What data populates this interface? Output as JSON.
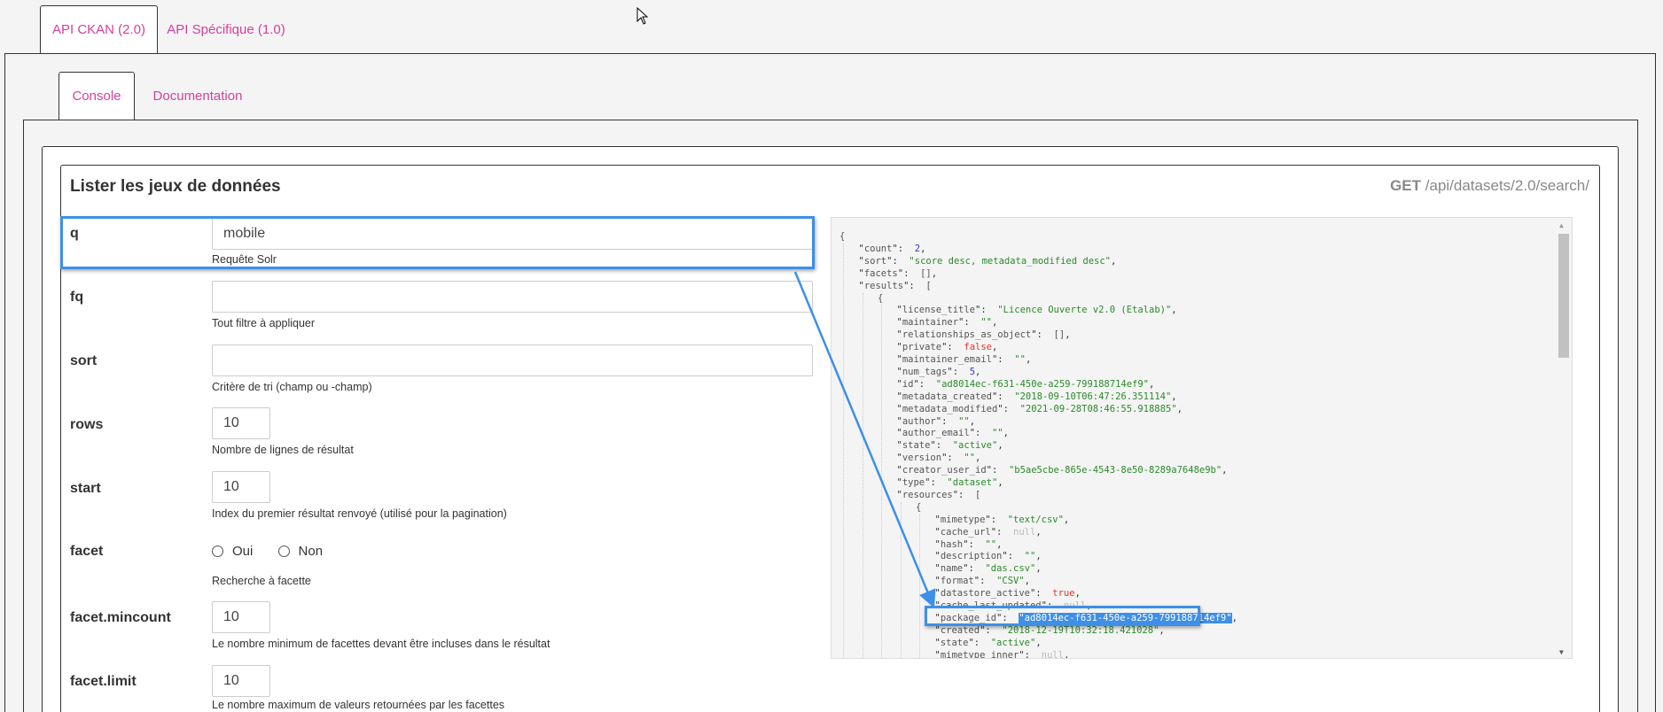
{
  "outer_tabs": [
    {
      "label": "API CKAN (2.0)",
      "active": true
    },
    {
      "label": "API Spécifique (1.0)",
      "active": false
    }
  ],
  "inner_tabs": [
    {
      "label": "Console",
      "active": true
    },
    {
      "label": "Documentation",
      "active": false
    }
  ],
  "card": {
    "title": "Lister les jeux de données",
    "method": "GET",
    "endpoint": "/api/datasets/2.0/search/"
  },
  "form": {
    "q": {
      "label": "q",
      "value": "mobile",
      "help": "Requête Solr"
    },
    "fq": {
      "label": "fq",
      "value": "",
      "help": "Tout filtre à appliquer"
    },
    "sort": {
      "label": "sort",
      "value": "",
      "help": "Critère de tri (champ ou -champ)"
    },
    "rows": {
      "label": "rows",
      "value": "10",
      "help": "Nombre de lignes de résultat"
    },
    "start": {
      "label": "start",
      "value": "10",
      "help": "Index du premier résultat renvoyé (utilisé pour la pagination)"
    },
    "facet": {
      "label": "facet",
      "options": [
        "Oui",
        "Non"
      ],
      "selected": null,
      "help": "Recherche à facette"
    },
    "facet_mincount": {
      "label": "facet.mincount",
      "value": "10",
      "help": "Le nombre minimum de facettes devant être incluses dans le résultat"
    },
    "facet_limit": {
      "label": "facet.limit",
      "value": "10",
      "help": "Le nombre maximum de valeurs retournées par les facettes"
    }
  },
  "colors": {
    "accent": "#d43f9e",
    "highlight": "#3d8fe8",
    "string": "#2b8a2b",
    "number": "#3535d8",
    "boolean": "#e8342c",
    "null": "#bbbbbb"
  },
  "response_lines": [
    {
      "i": 0,
      "raw": "{"
    },
    {
      "i": 1,
      "k": "count",
      "v": "2",
      "t": "n"
    },
    {
      "i": 1,
      "k": "sort",
      "v": "\"score desc, metadata_modified desc\"",
      "t": "s"
    },
    {
      "i": 1,
      "k": "facets",
      "v": "[]",
      "t": "k"
    },
    {
      "i": 1,
      "k": "results",
      "v": "[",
      "t": "k",
      "open": true
    },
    {
      "i": 2,
      "raw": "{"
    },
    {
      "i": 3,
      "k": "license_title",
      "v": "\"Licence Ouverte v2.0 (Etalab)\"",
      "t": "s"
    },
    {
      "i": 3,
      "k": "maintainer",
      "v": "\"\"",
      "t": "s"
    },
    {
      "i": 3,
      "k": "relationships_as_object",
      "v": "[]",
      "t": "k"
    },
    {
      "i": 3,
      "k": "private",
      "v": "false",
      "t": "b"
    },
    {
      "i": 3,
      "k": "maintainer_email",
      "v": "\"\"",
      "t": "s"
    },
    {
      "i": 3,
      "k": "num_tags",
      "v": "5",
      "t": "n"
    },
    {
      "i": 3,
      "k": "id",
      "v": "\"ad8014ec-f631-450e-a259-799188714ef9\"",
      "t": "s"
    },
    {
      "i": 3,
      "k": "metadata_created",
      "v": "\"2018-09-10T06:47:26.351114\"",
      "t": "s"
    },
    {
      "i": 3,
      "k": "metadata_modified",
      "v": "\"2021-09-28T08:46:55.918885\"",
      "t": "s"
    },
    {
      "i": 3,
      "k": "author",
      "v": "\"\"",
      "t": "s"
    },
    {
      "i": 3,
      "k": "author_email",
      "v": "\"\"",
      "t": "s"
    },
    {
      "i": 3,
      "k": "state",
      "v": "\"active\"",
      "t": "s"
    },
    {
      "i": 3,
      "k": "version",
      "v": "\"\"",
      "t": "s"
    },
    {
      "i": 3,
      "k": "creator_user_id",
      "v": "\"b5ae5cbe-865e-4543-8e50-8289a7648e9b\"",
      "t": "s"
    },
    {
      "i": 3,
      "k": "type",
      "v": "\"dataset\"",
      "t": "s"
    },
    {
      "i": 3,
      "k": "resources",
      "v": "[",
      "t": "k",
      "open": true
    },
    {
      "i": 4,
      "raw": "{"
    },
    {
      "i": 5,
      "k": "mimetype",
      "v": "\"text/csv\"",
      "t": "s"
    },
    {
      "i": 5,
      "k": "cache_url",
      "v": "null",
      "t": "z"
    },
    {
      "i": 5,
      "k": "hash",
      "v": "\"\"",
      "t": "s"
    },
    {
      "i": 5,
      "k": "description",
      "v": "\"\"",
      "t": "s"
    },
    {
      "i": 5,
      "k": "name",
      "v": "\"das.csv\"",
      "t": "s"
    },
    {
      "i": 5,
      "k": "format",
      "v": "\"CSV\"",
      "t": "s"
    },
    {
      "i": 5,
      "k": "datastore_active",
      "v": "true",
      "t": "b"
    },
    {
      "i": 5,
      "k": "cache_last_updated",
      "v": "null",
      "t": "z"
    },
    {
      "i": 5,
      "k": "package_id",
      "v": "\"ad8014ec-f631-450e-a259-799188714ef9\"",
      "t": "s",
      "selected": true
    },
    {
      "i": 5,
      "k": "created",
      "v": "\"2018-12-19T10:32:18.421028\"",
      "t": "s"
    },
    {
      "i": 5,
      "k": "state",
      "v": "\"active\"",
      "t": "s"
    },
    {
      "i": 5,
      "k": "mimetype_inner",
      "v": "null",
      "t": "z"
    }
  ]
}
